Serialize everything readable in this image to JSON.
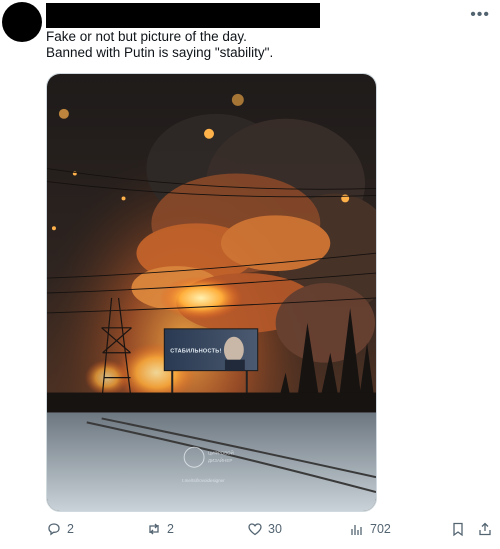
{
  "post": {
    "line1": "Fake or not but picture of the day.",
    "line2": "Banned with Putin is saying \"stability\"."
  },
  "media": {
    "billboard_text": "СТАБИЛЬНОСТЬ!",
    "watermark_line1": "ЦИФРОВОЙ",
    "watermark_line2": "ДИЗАЙНЕР",
    "watermark_handle": "t.me/tsifrovoidesigner"
  },
  "actions": {
    "replies": "2",
    "reposts": "2",
    "likes": "30",
    "views": "702"
  },
  "icons": {
    "more": "more-icon",
    "reply": "reply-icon",
    "repost": "repost-icon",
    "like": "like-icon",
    "views": "views-icon",
    "bookmark": "bookmark-icon",
    "share": "share-icon"
  }
}
